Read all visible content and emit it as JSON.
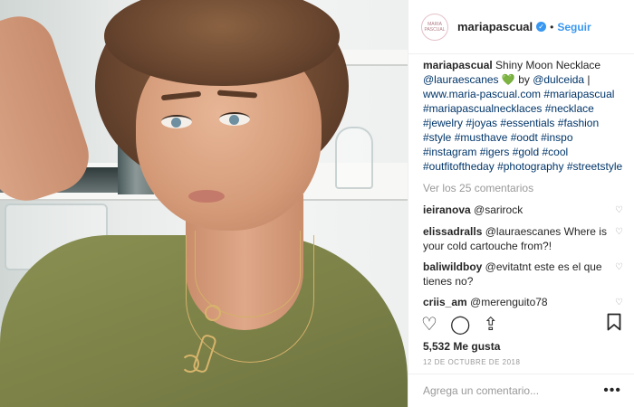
{
  "post": {
    "username": "mariapascual",
    "follow_label": "Seguir",
    "avatar_text": "MARIA PASCUAL",
    "caption": {
      "username": "mariapascual",
      "text_1": " Shiny Moon Necklace",
      "mention_1": "@lauraescanes",
      "heart": "💚",
      "by": " by ",
      "mention_2": "@dulceida",
      "sep": " |",
      "website": "www.maria-pascual.com",
      "hashtags": [
        "#mariapascual",
        "#mariapascualnecklaces",
        "#necklace",
        "#jewelry",
        "#joyas",
        "#essentials",
        "#fashion",
        "#style",
        "#musthave",
        "#oodt",
        "#inspo",
        "#instagram",
        "#igers",
        "#gold",
        "#cool",
        "#outfitoftheday",
        "#photography",
        "#streetstyle"
      ]
    },
    "view_all": "Ver los 25 comentarios",
    "comments": [
      {
        "user": "ieiranova",
        "text": "@sarirock"
      },
      {
        "user": "elissadralls",
        "text": "@lauraescanes Where is your cold cartouche from?!"
      },
      {
        "user": "baliwildboy",
        "text": "@evitatnt este es el que tienes no?"
      },
      {
        "user": "criis_am",
        "text": "@merenguito78"
      }
    ],
    "likes": "5,532 Me gusta",
    "date": "12 DE OCTUBRE DE 2018",
    "add_comment_placeholder": "Agrega un comentario...",
    "more_glyph": "•••"
  },
  "icons": {
    "like": "heart-icon",
    "comment": "comment-icon",
    "share": "share-icon",
    "save": "bookmark-icon",
    "verified": "verified-badge-icon"
  },
  "colors": {
    "link": "#003569",
    "accent": "#3897f0"
  }
}
